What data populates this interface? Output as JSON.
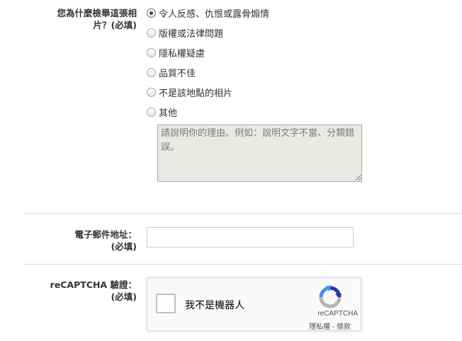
{
  "reason_field": {
    "label": "您為什麼檢舉這張相片？",
    "required": "(必填)",
    "options": [
      "令人反感、仇恨或露骨煽情",
      "版權或法律問題",
      "隱私權疑慮",
      "品質不佳",
      "不是該地點的相片",
      "其他"
    ],
    "selected_index": 0,
    "textarea_placeholder": "請說明你的理由。例如：說明文字不當、分類錯誤。"
  },
  "email_field": {
    "label": "電子郵件地址：",
    "required": "(必填)",
    "value": ""
  },
  "captcha_field": {
    "label": "reCAPTCHA 驗證：",
    "required": "(必填)",
    "checkbox_label": "我不是機器人",
    "brand": "reCAPTCHA",
    "privacy_link": "隱私權",
    "separator": " - ",
    "terms_link": "條款"
  },
  "colors": {
    "captcha_blue": "#1c3aa9",
    "captcha_lightblue": "#4a90e2",
    "captcha_gray": "#b4b4b4"
  }
}
